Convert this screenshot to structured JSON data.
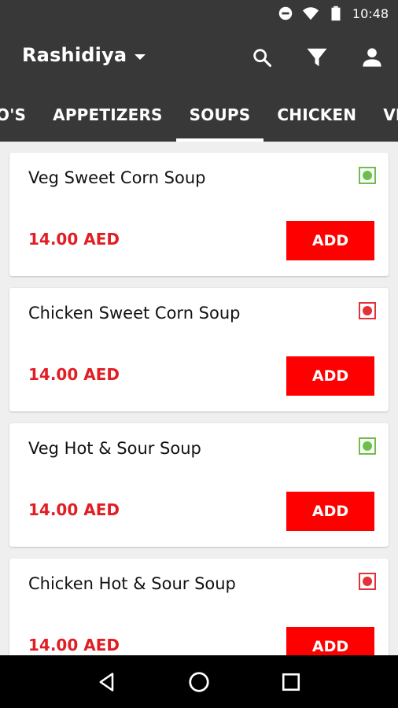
{
  "status_bar": {
    "time": "10:48",
    "icons": [
      "do-not-disturb-icon",
      "wifi-icon",
      "battery-icon"
    ]
  },
  "app_bar": {
    "location": "Rashidiya",
    "actions": [
      "search-icon",
      "filter-icon",
      "account-icon"
    ]
  },
  "tabs": [
    {
      "label": "O'S",
      "active": false
    },
    {
      "label": "APPETIZERS",
      "active": false
    },
    {
      "label": "SOUPS",
      "active": true
    },
    {
      "label": "CHICKEN",
      "active": false
    },
    {
      "label": "VEGET",
      "active": false
    }
  ],
  "items": [
    {
      "name": "Veg Sweet Corn Soup",
      "price": "14.00 AED",
      "type": "veg",
      "add_label": "ADD"
    },
    {
      "name": "Chicken Sweet Corn Soup",
      "price": "14.00 AED",
      "type": "nonveg",
      "add_label": "ADD"
    },
    {
      "name": "Veg Hot & Sour Soup",
      "price": "14.00 AED",
      "type": "veg",
      "add_label": "ADD"
    },
    {
      "name": "Chicken Hot & Sour Soup",
      "price": "14.00 AED",
      "type": "nonveg",
      "add_label": "ADD"
    }
  ],
  "colors": {
    "header": "#383838",
    "price": "#e01e24",
    "add_button": "#ff0000",
    "veg": "#6cc04a",
    "nonveg": "#e3313a"
  },
  "nav": [
    "back-icon",
    "home-icon",
    "recents-icon"
  ]
}
